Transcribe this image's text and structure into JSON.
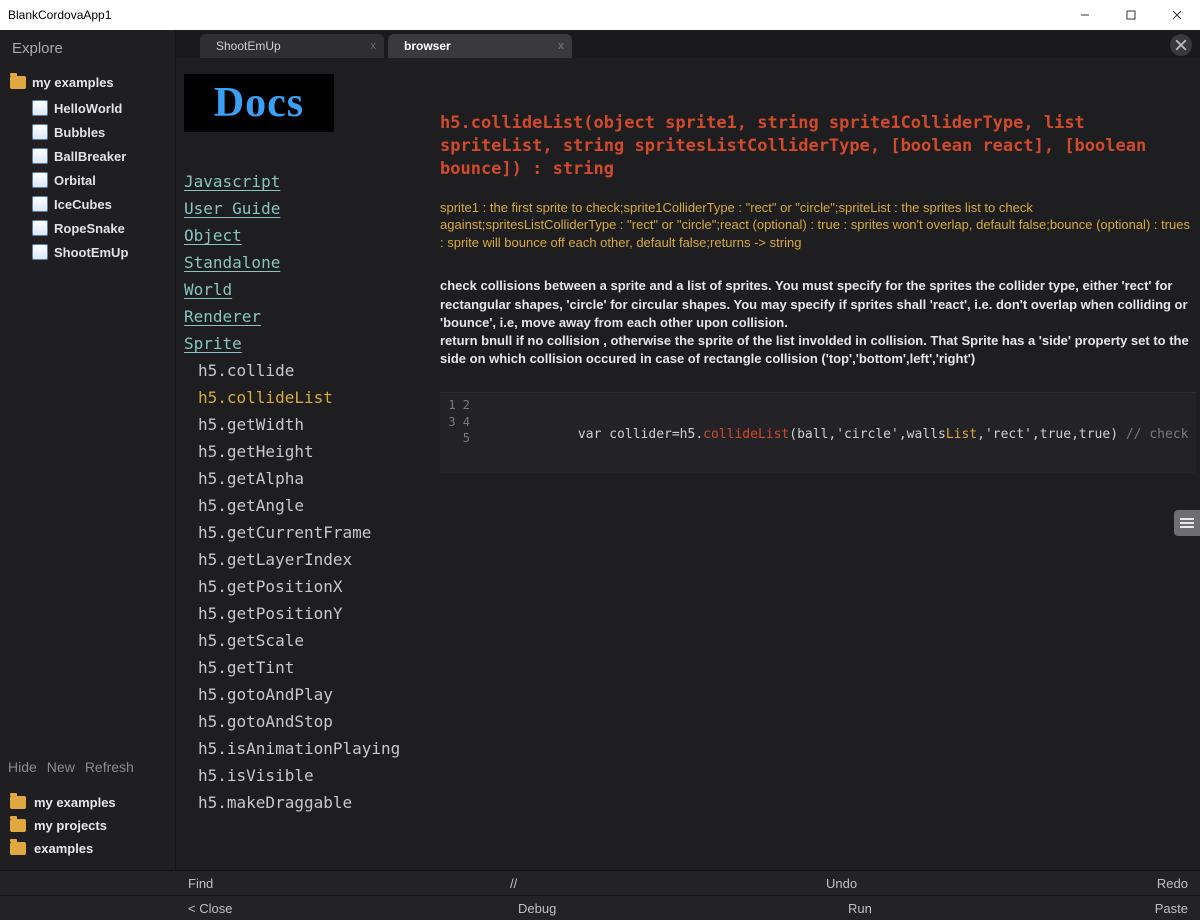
{
  "window": {
    "title": "BlankCordovaApp1"
  },
  "sidebar": {
    "header": "Explore",
    "folder": "my examples",
    "items": [
      "HelloWorld",
      "Bubbles",
      "BallBreaker",
      "Orbital",
      "IceCubes",
      "RopeSnake",
      "ShootEmUp"
    ],
    "actions": [
      "Hide",
      "New",
      "Refresh"
    ],
    "projects": [
      "my examples",
      "my projects",
      "examples"
    ]
  },
  "tabs": {
    "list": [
      {
        "label": "ShootEmUp",
        "active": false
      },
      {
        "label": "browser",
        "active": true
      }
    ]
  },
  "docs": {
    "logo": "Docs",
    "sections": [
      "Javascript",
      "User Guide",
      "Object",
      "Standalone",
      "World",
      "Renderer",
      "Sprite"
    ],
    "spriteMethods": [
      "h5.collide",
      "h5.collideList",
      "h5.getWidth",
      "h5.getHeight",
      "h5.getAlpha",
      "h5.getAngle",
      "h5.getCurrentFrame",
      "h5.getLayerIndex",
      "h5.getPositionX",
      "h5.getPositionY",
      "h5.getScale",
      "h5.getTint",
      "h5.gotoAndPlay",
      "h5.gotoAndStop",
      "h5.isAnimationPlaying",
      "h5.isVisible",
      "h5.makeDraggable"
    ],
    "selectedMethod": "h5.collideList",
    "signature": "h5.collideList(object sprite1, string sprite1ColliderType, list spriteList, string spritesListColliderType, [boolean react], [boolean bounce]) : string",
    "params": "sprite1 : the first sprite to check;sprite1ColliderType : \"rect\" or \"circle\";spriteList : the sprites list to check against;spritesListColliderType : \"rect\" or \"circle\";react (optional) : true : sprites won't overlap, default false;bounce (optional) : trues : sprite will bounce off each other, default false;returns -> string",
    "descA": "check collisions between a sprite and a list of sprites. You must specify for the sprites the collider type, either 'rect' for rectangular shapes, 'circle' for circular shapes. You may specify if sprites shall 'react', i.e. don't overlap when colliding or 'bounce', i.e, move away from each other upon collision.",
    "descB": "return bnull if no collision , otherwise the sprite of the list involded in collision. That Sprite has a 'side' property set to the side on which collision occured in case of rectangle collision ('top','bottom',left','right')",
    "code": {
      "lineNumbers": [
        "1",
        "2",
        "3",
        "4",
        "5"
      ],
      "t1": "var",
      "t2": " collider=h5.",
      "t3": "collideList",
      "t4": "(ball,",
      "t5": "'circle'",
      "t6": ",walls",
      "t7": "List",
      "t8": ",",
      "t9": "'rect'",
      "t10": ",",
      "t11": "true",
      "t12": ",",
      "t13": "true",
      "t14": ") ",
      "t15": "// check wheter ball is co"
    }
  },
  "status1": {
    "a": "Find",
    "b": "//",
    "c": "Undo",
    "d": "Redo"
  },
  "status2": {
    "a": "< Close",
    "b": "Debug",
    "c": "Run",
    "d": "Paste"
  }
}
